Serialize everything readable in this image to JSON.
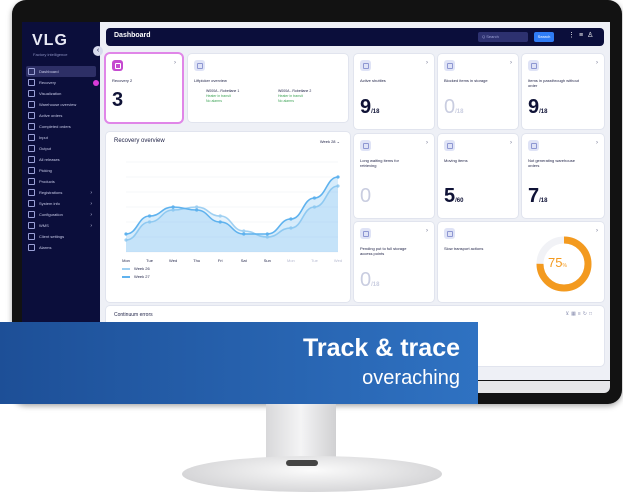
{
  "app": {
    "logo": "VLG",
    "logo_sub": "Factory intelligence"
  },
  "topbar": {
    "title": "Dashboard",
    "search_placeholder": "Q Search",
    "button_label": "Search",
    "icons": [
      "notification-icon",
      "menu-icon",
      "user-icon"
    ]
  },
  "sidebar": {
    "items": [
      {
        "label": "Dashboard",
        "icon": "dashboard-icon",
        "active": true,
        "arrow": false
      },
      {
        "label": "Recovery",
        "icon": "recovery-icon",
        "active": false,
        "arrow": false
      },
      {
        "label": "Visualization",
        "icon": "visualization-icon",
        "active": false,
        "arrow": false
      },
      {
        "label": "Warehouse overview",
        "icon": "warehouse-icon",
        "active": false,
        "arrow": false
      },
      {
        "label": "Active orders",
        "icon": "orders-icon",
        "active": false,
        "arrow": false
      },
      {
        "label": "Completed orders",
        "icon": "completed-icon",
        "active": false,
        "arrow": false
      },
      {
        "label": "Input",
        "icon": "input-icon",
        "active": false,
        "arrow": false
      },
      {
        "label": "Output",
        "icon": "output-icon",
        "active": false,
        "arrow": false
      },
      {
        "label": "All releases",
        "icon": "releases-icon",
        "active": false,
        "arrow": false
      },
      {
        "label": "Picking",
        "icon": "picking-icon",
        "active": false,
        "arrow": false
      },
      {
        "label": "Products",
        "icon": "products-icon",
        "active": false,
        "arrow": false
      },
      {
        "label": "Registrations",
        "icon": "registrations-icon",
        "active": false,
        "arrow": true
      },
      {
        "label": "System info",
        "icon": "system-icon",
        "active": false,
        "arrow": true
      },
      {
        "label": "Configuration",
        "icon": "config-icon",
        "active": false,
        "arrow": true
      },
      {
        "label": "WMS",
        "icon": "wms-icon",
        "active": false,
        "arrow": true
      },
      {
        "label": "Client settings",
        "icon": "settings-icon",
        "active": false,
        "arrow": false
      },
      {
        "label": "Alarms",
        "icon": "alarm-icon",
        "active": false,
        "arrow": false
      }
    ]
  },
  "cards": {
    "recovery": {
      "label": "Recovery 2",
      "value": "3"
    },
    "liftpicker": {
      "title": "Liftpicker overview",
      "col1": {
        "name": "W000A - Robetlane 1",
        "lines": [
          "Heater in transit",
          "No alarms"
        ]
      },
      "col2": {
        "name": "W000A - Robetlane 2",
        "lines": [
          "Heater in transit",
          "No alarms"
        ]
      }
    },
    "active_shuttles": {
      "label": "Active shuttles",
      "value": "9",
      "denominator": "/18"
    },
    "blocked_items": {
      "label": "Blocked items in storage",
      "value": "0",
      "denominator": "/18"
    },
    "passthrough": {
      "label": "Items in passthrough without order",
      "value": "9",
      "denominator": "/18"
    },
    "long_waiting": {
      "label": "Long waiting items for retrieving",
      "value": "0"
    },
    "moving_items": {
      "label": "Moving items",
      "value": "5",
      "denominator": "/60"
    },
    "not_generating": {
      "label": "Not generating warehouse orders",
      "value": "7",
      "denominator": "/18"
    },
    "pending_storage": {
      "label": "Pending put to full storage access points",
      "value": "0",
      "denominator": "/18"
    },
    "slow_transport": {
      "label": "Slow transport actions",
      "gauge_value": "75",
      "gauge_unit": "%",
      "gauge_fraction": 0.75
    }
  },
  "recovery_chart": {
    "title": "Recovery overview",
    "week_select": "Week 28 ⌄",
    "colors": {
      "a": "#9fd0f2",
      "b": "#5fb2ee"
    },
    "chart_data": {
      "type": "area",
      "categories": [
        "Mon",
        "Tue",
        "Wed",
        "Thu",
        "Fri",
        "Sat",
        "Sun",
        "Mon",
        "Tue",
        "Wed"
      ],
      "ylim": [
        0,
        30
      ],
      "series": [
        {
          "name": "Week 26",
          "values": [
            4,
            10,
            14,
            15,
            12,
            7,
            5,
            8,
            15,
            22
          ]
        },
        {
          "name": "Week 27",
          "values": [
            6,
            12,
            15,
            14,
            10,
            6,
            6,
            11,
            18,
            25
          ]
        }
      ]
    }
  },
  "footer": {
    "title": "Continuum errors",
    "icons": [
      "filter-icon",
      "grid-icon",
      "list-icon",
      "refresh-icon",
      "expand-icon"
    ]
  },
  "banner": {
    "title": "Track & trace",
    "subtitle": "overaching"
  }
}
